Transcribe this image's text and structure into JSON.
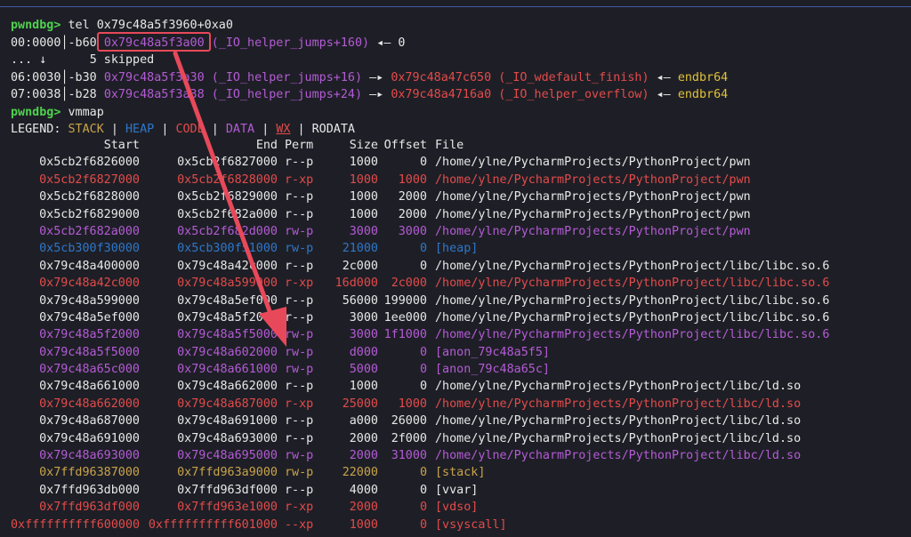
{
  "terminal": {
    "prompt": "pwndbg>",
    "cmd1": "tel 0x79c48a5f3960+0xa0",
    "tel_lines": [
      {
        "idx": "00:0000",
        "off": "-b60",
        "addr": "0x79c48a5f3a00",
        "sym": "(_IO_helper_jumps+160)",
        "arrow": "◂—",
        "val": "0",
        "val2": "",
        "extra": ""
      },
      {
        "idx": "... ↓",
        "off": "",
        "addr": "",
        "sym": "",
        "arrow": "",
        "val": "5 skipped",
        "val2": "",
        "extra": ""
      },
      {
        "idx": "06:0030",
        "off": "-b30",
        "addr": "0x79c48a5f3a30",
        "sym": "(_IO_helper_jumps+16)",
        "arrow": "—▸",
        "val": "0x79c48a47c650",
        "val2": "(_IO_wdefault_finish)",
        "extra": "endbr64"
      },
      {
        "idx": "07:0038",
        "off": "-b28",
        "addr": "0x79c48a5f3a38",
        "sym": "(_IO_helper_jumps+24)",
        "arrow": "—▸",
        "val": "0x79c48a4716a0",
        "val2": "(_IO_helper_overflow)",
        "extra": "endbr64"
      }
    ],
    "arrow_back": "◂—",
    "cmd2": "vmmap",
    "legend": {
      "label": "LEGEND:",
      "stack": "STACK",
      "heap": "HEAP",
      "code": "CODE",
      "data": "DATA",
      "wx": "WX",
      "rodata": "RODATA",
      "sep": "|"
    },
    "headers": {
      "start": "Start",
      "end": "End",
      "perm": "Perm",
      "size": "Size",
      "offset": "Offset",
      "file": "File"
    },
    "rows": [
      {
        "start": "0x5cb2f6826000",
        "end": "0x5cb2f6827000",
        "perm": "r--p",
        "size": "1000",
        "offset": "0",
        "file": "/home/ylne/PycharmProjects/PythonProject/pwn",
        "color": "white"
      },
      {
        "start": "0x5cb2f6827000",
        "end": "0x5cb2f6828000",
        "perm": "r-xp",
        "size": "1000",
        "offset": "1000",
        "file": "/home/ylne/PycharmProjects/PythonProject/pwn",
        "color": "red"
      },
      {
        "start": "0x5cb2f6828000",
        "end": "0x5cb2f6829000",
        "perm": "r--p",
        "size": "1000",
        "offset": "2000",
        "file": "/home/ylne/PycharmProjects/PythonProject/pwn",
        "color": "white"
      },
      {
        "start": "0x5cb2f6829000",
        "end": "0x5cb2f682a000",
        "perm": "r--p",
        "size": "1000",
        "offset": "2000",
        "file": "/home/ylne/PycharmProjects/PythonProject/pwn",
        "color": "white"
      },
      {
        "start": "0x5cb2f682a000",
        "end": "0x5cb2f682d000",
        "perm": "rw-p",
        "size": "3000",
        "offset": "3000",
        "file": "/home/ylne/PycharmProjects/PythonProject/pwn",
        "color": "purple"
      },
      {
        "start": "0x5cb300f30000",
        "end": "0x5cb300f51000",
        "perm": "rw-p",
        "size": "21000",
        "offset": "0",
        "file": "[heap]",
        "color": "blue"
      },
      {
        "start": "0x79c48a400000",
        "end": "0x79c48a42c000",
        "perm": "r--p",
        "size": "2c000",
        "offset": "0",
        "file": "/home/ylne/PycharmProjects/PythonProject/libc/libc.so.6",
        "color": "white"
      },
      {
        "start": "0x79c48a42c000",
        "end": "0x79c48a599000",
        "perm": "r-xp",
        "size": "16d000",
        "offset": "2c000",
        "file": "/home/ylne/PycharmProjects/PythonProject/libc/libc.so.6",
        "color": "red"
      },
      {
        "start": "0x79c48a599000",
        "end": "0x79c48a5ef000",
        "perm": "r--p",
        "size": "56000",
        "offset": "199000",
        "file": "/home/ylne/PycharmProjects/PythonProject/libc/libc.so.6",
        "color": "white"
      },
      {
        "start": "0x79c48a5ef000",
        "end": "0x79c48a5f2000",
        "perm": "r--p",
        "size": "3000",
        "offset": "1ee000",
        "file": "/home/ylne/PycharmProjects/PythonProject/libc/libc.so.6",
        "color": "white"
      },
      {
        "start": "0x79c48a5f2000",
        "end": "0x79c48a5f5000",
        "perm": "rw-p",
        "size": "3000",
        "offset": "1f1000",
        "file": "/home/ylne/PycharmProjects/PythonProject/libc/libc.so.6",
        "color": "purple"
      },
      {
        "start": "0x79c48a5f5000",
        "end": "0x79c48a602000",
        "perm": "rw-p",
        "size": "d000",
        "offset": "0",
        "file": "[anon_79c48a5f5]",
        "color": "purple"
      },
      {
        "start": "0x79c48a65c000",
        "end": "0x79c48a661000",
        "perm": "rw-p",
        "size": "5000",
        "offset": "0",
        "file": "[anon_79c48a65c]",
        "color": "purple"
      },
      {
        "start": "0x79c48a661000",
        "end": "0x79c48a662000",
        "perm": "r--p",
        "size": "1000",
        "offset": "0",
        "file": "/home/ylne/PycharmProjects/PythonProject/libc/ld.so",
        "color": "white"
      },
      {
        "start": "0x79c48a662000",
        "end": "0x79c48a687000",
        "perm": "r-xp",
        "size": "25000",
        "offset": "1000",
        "file": "/home/ylne/PycharmProjects/PythonProject/libc/ld.so",
        "color": "red"
      },
      {
        "start": "0x79c48a687000",
        "end": "0x79c48a691000",
        "perm": "r--p",
        "size": "a000",
        "offset": "26000",
        "file": "/home/ylne/PycharmProjects/PythonProject/libc/ld.so",
        "color": "white"
      },
      {
        "start": "0x79c48a691000",
        "end": "0x79c48a693000",
        "perm": "r--p",
        "size": "2000",
        "offset": "2f000",
        "file": "/home/ylne/PycharmProjects/PythonProject/libc/ld.so",
        "color": "white"
      },
      {
        "start": "0x79c48a693000",
        "end": "0x79c48a695000",
        "perm": "rw-p",
        "size": "2000",
        "offset": "31000",
        "file": "/home/ylne/PycharmProjects/PythonProject/libc/ld.so",
        "color": "purple"
      },
      {
        "start": "0x7ffd96387000",
        "end": "0x7ffd963a9000",
        "perm": "rw-p",
        "size": "22000",
        "offset": "0",
        "file": "[stack]",
        "color": "brown"
      },
      {
        "start": "0x7ffd963db000",
        "end": "0x7ffd963df000",
        "perm": "r--p",
        "size": "4000",
        "offset": "0",
        "file": "[vvar]",
        "color": "white"
      },
      {
        "start": "0x7ffd963df000",
        "end": "0x7ffd963e1000",
        "perm": "r-xp",
        "size": "2000",
        "offset": "0",
        "file": "[vdso]",
        "color": "red"
      },
      {
        "start": "0xffffffffff600000",
        "end": "0xffffffffff601000",
        "perm": "--xp",
        "size": "1000",
        "offset": "0",
        "file": "[vsyscall]",
        "color": "red"
      }
    ]
  },
  "colors": {
    "background": "#1e1f26",
    "prompt": "#4fd14f",
    "code": "#e34b4b",
    "data": "#b45bd6",
    "heap": "#2e77c9",
    "stack": "#c9a34a",
    "text": "#e8e8e8",
    "annotation": "#e8495a"
  }
}
